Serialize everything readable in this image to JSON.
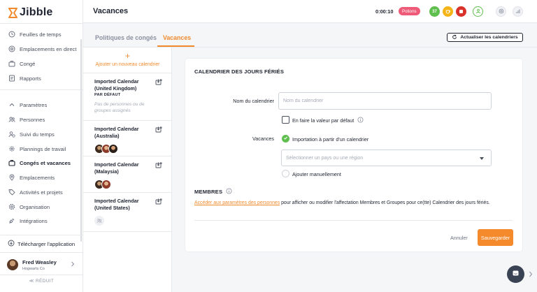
{
  "app": {
    "logo_text": "Jibble",
    "brand_color": "#f08a2d"
  },
  "sidebar": {
    "items": [
      {
        "label": "Feuilles de temps",
        "icon": "clock-icon"
      },
      {
        "label": "Emplacements en direct",
        "icon": "location-pin-icon"
      },
      {
        "label": "Congé",
        "icon": "briefcase-icon"
      },
      {
        "label": "Rapports",
        "icon": "report-icon"
      },
      {
        "label": "Paramètres",
        "icon": "chevron-up-icon"
      },
      {
        "label": "Personnes",
        "icon": "people-icon"
      },
      {
        "label": "Suivi du temps",
        "icon": "user-clock-icon"
      },
      {
        "label": "Plannings de travail",
        "icon": "schedule-icon"
      },
      {
        "label": "Congés et vacances",
        "icon": "briefcase-icon",
        "active": true
      },
      {
        "label": "Emplacements",
        "icon": "location-pin-icon"
      },
      {
        "label": "Activités et projets",
        "icon": "tag-icon"
      },
      {
        "label": "Organisation",
        "icon": "gear-icon"
      },
      {
        "label": "Intégrations",
        "icon": "plug-icon"
      }
    ],
    "download_app": "Télécharger l'application",
    "user": {
      "name": "Fred Weasley",
      "org": "Hogwarts Co"
    },
    "collapse_label": "≪ RÉDUIT"
  },
  "header": {
    "title": "Vacances",
    "timer": "0:00:10",
    "project": "Potions",
    "count_badge": "37",
    "colors": {
      "project": "#ef5a78",
      "count": "#5fbf4e",
      "coffee": "#f5b417",
      "stop": "#d9322b"
    }
  },
  "tabs": {
    "items": [
      {
        "label": "Politiques de congés"
      },
      {
        "label": "Vacances",
        "active": true
      }
    ],
    "refresh_label": "Actualiser les calendriers"
  },
  "calendars": {
    "add_label": "Ajouter un nouveau calendrier",
    "items": [
      {
        "name": "Imported Calendar (United Kingdom)",
        "default_label": "PAR DÉFAUT",
        "empty_text": "Pas de personnes ou de groupes assignés"
      },
      {
        "name": "Imported Calendar (Australia)"
      },
      {
        "name": "Imported Calendar (Malaysia)"
      },
      {
        "name": "Imported Calendar (United States)"
      }
    ]
  },
  "form": {
    "title": "CALENDRIER DES JOURS FÉRIÉS",
    "name_label": "Nom du calendrier",
    "name_placeholder": "Nom du calendrier",
    "name_value": "",
    "default_checkbox_label": "En faire la valeur par défaut",
    "holidays_label": "Vacances",
    "import_option": "Importation à partir d'un calendrier",
    "country_placeholder": "Sélectionner un pays ou une région",
    "manual_option": "Ajouter manuellement",
    "members_title": "MEMBRES",
    "members_link": "Accéder aux paramètres des personnes",
    "members_text": " pour afficher ou modifier l'affectation Membres et Groupes pour ce(tte) Calendrier des jours fériés.",
    "cancel_label": "Annuler",
    "save_label": "Sauvegarder"
  }
}
